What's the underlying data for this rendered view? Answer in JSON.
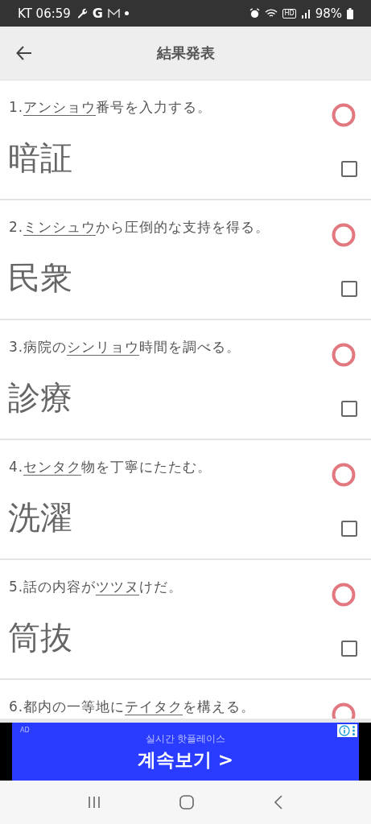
{
  "status_bar": {
    "carrier": "KT",
    "time": "06:59",
    "google": "G",
    "hd": "HD",
    "battery": "98%"
  },
  "app_bar": {
    "title": "結果発表"
  },
  "questions": [
    {
      "number": "1.",
      "word": "アンショウ",
      "after": "番号を入力する。",
      "answer": "暗証",
      "kind": "correct",
      "checked": false
    },
    {
      "number": "2.",
      "word": "ミンシュウ",
      "after": "から圧倒的な支持を得る。",
      "answer": "民衆",
      "kind": "correct",
      "checked": false
    },
    {
      "number": "3.",
      "before": "病院の",
      "word": "シンリョウ",
      "after": "時間を調べる。",
      "answer": "診療",
      "kind": "correct",
      "checked": false
    },
    {
      "number": "4.",
      "word": "センタク",
      "after": "物を丁寧にたたむ。",
      "answer": "洗濯",
      "kind": "correct",
      "checked": false
    },
    {
      "number": "5.",
      "before": "話の内容が",
      "word": "ツツヌ",
      "after": "けだ。",
      "answer": "筒抜",
      "kind": "correct",
      "checked": false
    },
    {
      "number": "6.",
      "before": "都内の一等地に",
      "word": "テイタク",
      "after": "を構える。",
      "kind": "correct"
    }
  ],
  "ad": {
    "badge": "AD",
    "subtitle": "실시간 핫플레이스",
    "headline": "계속보기 >"
  }
}
